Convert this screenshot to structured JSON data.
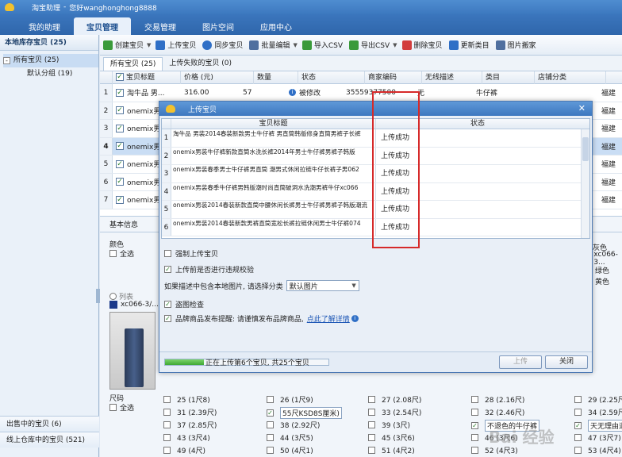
{
  "app": {
    "title": "淘宝助理",
    "greeting": "您好wanghonghong8888",
    "nav": [
      "我的助理",
      "宝贝管理",
      "交易管理",
      "图片空间",
      "应用中心"
    ],
    "active_nav": "宝贝管理"
  },
  "sidebar": {
    "header": "本地库存宝贝 (25)",
    "tree": [
      {
        "label": "所有宝贝 (25)",
        "expand": "-"
      },
      {
        "label": "默认分组 (19)"
      }
    ],
    "bottom": [
      "出售中的宝贝 (6)",
      "线上仓库中的宝贝 (521)"
    ]
  },
  "toolbar": {
    "buttons": [
      {
        "label": "创建宝贝",
        "icon": "create-icon",
        "color": "#3a9a3a"
      },
      {
        "label": "上传宝贝",
        "icon": "upload-icon",
        "color": "#2f6fc6"
      },
      {
        "label": "同步宝贝",
        "icon": "sync-icon",
        "color": "#2f6fc6"
      },
      {
        "label": "批量编辑",
        "icon": "batch-edit-icon",
        "color": "#4f6f9f"
      },
      {
        "label": "导入CSV",
        "icon": "import-csv-icon",
        "color": "#3a9a3a"
      },
      {
        "label": "导出CSV",
        "icon": "export-csv-icon",
        "color": "#3a9a3a"
      },
      {
        "label": "删除宝贝",
        "icon": "delete-icon",
        "color": "#d23c3c"
      },
      {
        "label": "更新类目",
        "icon": "update-category-icon",
        "color": "#2f6fc6"
      },
      {
        "label": "图片搬家",
        "icon": "image-move-icon",
        "color": "#4f6f9f"
      }
    ]
  },
  "subtabs": [
    "所有宝贝 (25)",
    "上传失败的宝贝 (0)"
  ],
  "grid": {
    "columns": [
      "宝贝标题",
      "价格 (元)",
      "数量",
      "状态",
      "商家编码",
      "无线描述",
      "类目",
      "店铺分类"
    ],
    "first_row": {
      "title": "淘牛品 男...",
      "price": "316.00",
      "qty": "57",
      "status": "被修改",
      "code": "35559377500",
      "mobile_desc": "无",
      "category": "牛仔裤"
    },
    "rows": [
      {
        "num": "1",
        "title": "淘牛品 男...",
        "region": "福建"
      },
      {
        "num": "2",
        "title": "onemix男...",
        "region": "福建"
      },
      {
        "num": "3",
        "title": "onemix男...",
        "region": "福建"
      },
      {
        "num": "4",
        "title": "onemix男...",
        "region": "福建"
      },
      {
        "num": "5",
        "title": "onemix男...",
        "region": "福建"
      },
      {
        "num": "6",
        "title": "onemix男...",
        "region": "福建"
      },
      {
        "num": "7",
        "title": "onemix男...",
        "region": "福建"
      }
    ]
  },
  "detail": {
    "tab": "基本信息",
    "color_label": "颜色",
    "select_all": "全选",
    "list_label": "列表",
    "sku_label": "xc066-3/...",
    "size_label": "尺码",
    "right_colors": [
      {
        "label": "浅灰色",
        "color": "#c8c8c8"
      },
      {
        "label": "xc066-3...",
        "color": "#1c3a8a"
      },
      {
        "label": "绿色",
        "color": "#2fa02f"
      },
      {
        "label": "黄色",
        "color": "#e6c21f"
      }
    ],
    "sizes": [
      [
        "25 (1尺8)",
        "26 (1尺9)",
        "27 (2.08尺)",
        "28 (2.16尺)",
        "29 (2.25尺)"
      ],
      [
        "31 (2.39尺)",
        "55尺KSD8S厘米)",
        "33 (2.54尺)",
        "32 (2.46尺)",
        "34 (2.59尺)"
      ],
      [
        "37 (2.85尺)",
        "38 (2.92尺)",
        "39 (3尺)",
        "不退色的牛仔裤",
        "天无理由退"
      ],
      [
        "43 (3尺4)",
        "44 (3尺5)",
        "45 (3尺6)",
        "46 (3尺6)",
        "47 (3尺7)"
      ],
      [
        "49 (4尺)",
        "50 (4尺1)",
        "51 (4尺2)",
        "52 (4尺3)",
        "53 (4尺4)"
      ]
    ]
  },
  "dialog": {
    "title": "上传宝贝",
    "columns": [
      "宝贝标题",
      "状态"
    ],
    "rows": [
      {
        "num": "1",
        "title": "淘牛品 男装2014春装新款男士牛仔裤 男直筒韩版修身直筒男裤子长裤",
        "status": "上传成功"
      },
      {
        "num": "2",
        "title": "onemix男装牛仔裤新款直筒水洗长裤2014年男士牛仔裤男裤子韩版",
        "status": "上传成功"
      },
      {
        "num": "3",
        "title": "onemix男装春季男士牛仔裤男直筒 潮男式休闲拉链牛仔长裤子男062",
        "status": "上传成功"
      },
      {
        "num": "4",
        "title": "onemix男装春季牛仔裤男韩版潮时尚直筒破洞水洗潮男裤牛仔xc066",
        "status": "上传成功"
      },
      {
        "num": "5",
        "title": "onemix男装2014春装新款直筒中腰休闲长裤男士牛仔裤男裤子韩版潮流",
        "status": "上传成功"
      },
      {
        "num": "6",
        "title": "onemix男装2014春装新款男裤直筒宽松长裤拉链休闲男士牛仔裤074",
        "status": "上传成功"
      }
    ],
    "force_upload": "强制上传宝贝",
    "force_checked": false,
    "validate": "上传前是否进行违规校验",
    "validate_checked": true,
    "local_image_prompt": "如果描述中包含本地图片, 请选择分类",
    "local_image_select": "默认图片",
    "theft_check": "盗图检查",
    "theft_checked": true,
    "brand_notice": "品牌商品发布提醒: 请谨慎发布品牌商品,",
    "brand_link": "点此了解详情",
    "brand_checked": true,
    "progress_text": "正在上传第6个宝贝, 共25个宝贝",
    "progress_fraction": 0.24,
    "upload_button": "上传",
    "close_button": "关闭"
  },
  "watermark": "Bai 经验"
}
